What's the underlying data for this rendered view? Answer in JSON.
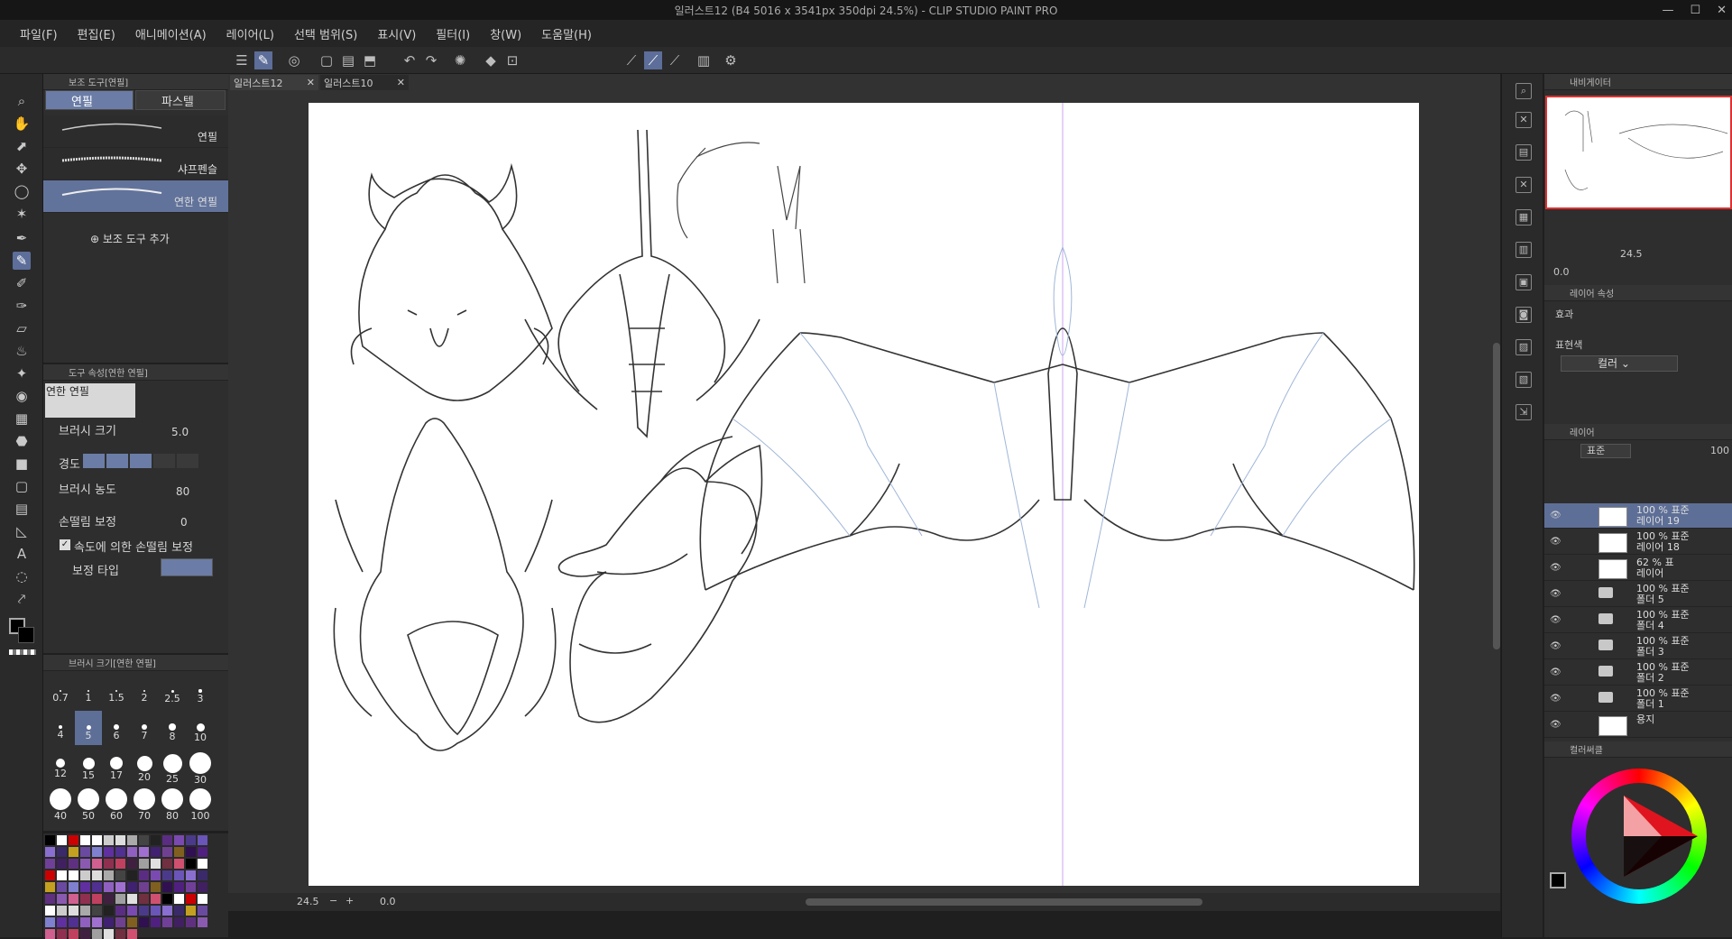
{
  "window": {
    "title": "일러스트12 (B4 5016 x 3541px 350dpi 24.5%) - CLIP STUDIO PAINT PRO"
  },
  "menu": [
    "파일(F)",
    "편집(E)",
    "애니메이션(A)",
    "레이어(L)",
    "선택 범위(S)",
    "표시(V)",
    "필터(I)",
    "창(W)",
    "도움말(H)"
  ],
  "subtool_panel": {
    "title": "보조 도구[연필]",
    "tabs": [
      "연필",
      "파스텔"
    ],
    "brushes": [
      "연필",
      "샤프펜슬",
      "연한 연필"
    ],
    "add_label": "보조 도구 추가"
  },
  "tool_property": {
    "title": "도구 속성[연한 연필]",
    "preset_name": "연한 연필",
    "brush_size_label": "브러시 크기",
    "brush_size_value": "5.0",
    "hardness_label": "경도",
    "density_label": "브러시 농도",
    "density_value": "80",
    "stabilization_label": "손떨림 보정",
    "stabilization_value": "0",
    "speed_stab_label": "속도에 의한 손떨림 보정",
    "correction_type_label": "보정 타입"
  },
  "brush_size_panel": {
    "title": "브러시 크기[연한 연필]",
    "sizes": [
      "0.7",
      "1",
      "1.5",
      "2",
      "2.5",
      "3",
      "4",
      "5",
      "6",
      "7",
      "8",
      "10",
      "12",
      "15",
      "17",
      "20",
      "25",
      "30",
      "40",
      "50",
      "60",
      "70",
      "80",
      "100"
    ]
  },
  "document_tabs": [
    "일러스트12",
    "일러스트10"
  ],
  "status": {
    "zoom": "24.5",
    "angle": "0.0"
  },
  "navigator": {
    "title": "내비게이터",
    "zoom": "24.5",
    "angle": "0.0"
  },
  "layer_property": {
    "title": "레이어 속성",
    "effect_label": "효과",
    "expression_label": "표현색",
    "expression_value": "컬러"
  },
  "layers_panel": {
    "title": "레이어",
    "blend": "표준",
    "opacity": "100",
    "layers": [
      {
        "line1": "100 % 표준",
        "line2": "레이어 19"
      },
      {
        "line1": "100 % 표준",
        "line2": "레이어 18"
      },
      {
        "line1": "62 % 표",
        "line2": "레이어"
      },
      {
        "line1": "100 % 표준",
        "line2": "폴더 5"
      },
      {
        "line1": "100 % 표준",
        "line2": "폴더 4"
      },
      {
        "line1": "100 % 표준",
        "line2": "폴더 3"
      },
      {
        "line1": "100 % 표준",
        "line2": "폴더 2"
      },
      {
        "line1": "100 % 표준",
        "line2": "폴더 1"
      },
      {
        "line1": "",
        "line2": "용지"
      }
    ]
  },
  "color_panel": {
    "title": "컬러써클"
  },
  "colors": {
    "accent": "#5c6e99",
    "paper": "#ffffff",
    "guide": "#b07fe0"
  }
}
